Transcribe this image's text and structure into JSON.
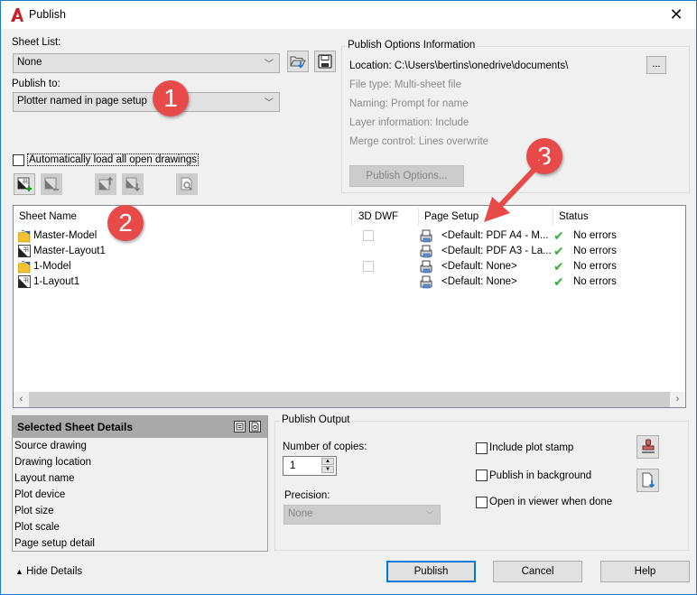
{
  "window": {
    "title": "Publish",
    "close_label": "✕"
  },
  "sheet_list": {
    "label": "Sheet List:",
    "value": "None"
  },
  "publish_to": {
    "label": "Publish to:",
    "value": "Plotter named in page setup"
  },
  "publish_options_info": {
    "title": "Publish Options Information",
    "location": "Location:  C:\\Users\\bertins\\onedrive\\documents\\",
    "browse_label": "...",
    "file_type": "File type: Multi-sheet file",
    "naming": "Naming: Prompt for name",
    "layer_info": "Layer information: Include",
    "merge_control": "Merge control: Lines overwrite",
    "options_button": "Publish Options..."
  },
  "auto_load": {
    "label": "Automatically load all open drawings",
    "checked": false
  },
  "sheet_table": {
    "columns": [
      "Sheet Name",
      "3D DWF",
      "Page Setup",
      "Status"
    ],
    "rows": [
      {
        "name": "Master-Model",
        "type": "model",
        "dwf3d": true,
        "page_setup": "<Default: PDF A4 - M...",
        "status": "No errors"
      },
      {
        "name": "Master-Layout1",
        "type": "layout",
        "dwf3d": false,
        "page_setup": "<Default: PDF A3 - La...",
        "status": "No errors"
      },
      {
        "name": "1-Model",
        "type": "model",
        "dwf3d": true,
        "page_setup": "<Default: None>",
        "status": "No errors"
      },
      {
        "name": "1-Layout1",
        "type": "layout",
        "dwf3d": false,
        "page_setup": "<Default: None>",
        "status": "No errors"
      }
    ]
  },
  "details": {
    "title": "Selected Sheet Details",
    "items": [
      "Source drawing",
      "Drawing location",
      "Layout name",
      "Plot device",
      "Plot size",
      "Plot scale",
      "Page setup detail"
    ]
  },
  "publish_output": {
    "title": "Publish Output",
    "copies_label": "Number of copies:",
    "copies_value": "1",
    "precision_label": "Precision:",
    "precision_value": "None",
    "include_stamp": "Include plot stamp",
    "publish_background": "Publish in background",
    "open_viewer": "Open in viewer when done"
  },
  "footer": {
    "hide_details": "Hide Details",
    "publish": "Publish",
    "cancel": "Cancel",
    "help": "Help"
  },
  "annotations": [
    "1",
    "2",
    "3"
  ],
  "colors": {
    "accent": "#0078d7",
    "badge": "#e84a4a",
    "ok": "#34b233"
  }
}
